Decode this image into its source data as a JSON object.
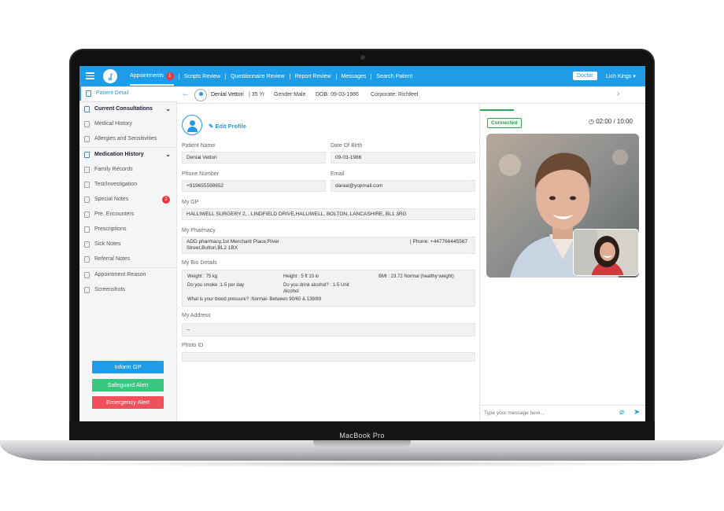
{
  "device": {
    "label": "MacBook Pro"
  },
  "header": {
    "nav": [
      {
        "label": "Appointments",
        "badge": "1",
        "active": true
      },
      {
        "label": "Scripts Review"
      },
      {
        "label": "Questionnaire Review"
      },
      {
        "label": "Report Review"
      },
      {
        "label": "Messages"
      },
      {
        "label": "Search Patient"
      }
    ],
    "role": "Doctor",
    "user": "Lich Kings"
  },
  "sidebar": {
    "items": [
      {
        "label": "Patient Detail"
      },
      {
        "label": "Current Consultations"
      },
      {
        "label": "Medical History"
      },
      {
        "label": "Allergies and Sensitivities"
      },
      {
        "label": "Medication History"
      },
      {
        "label": "Family Records"
      },
      {
        "label": "Test/Investigation"
      },
      {
        "label": "Special Notes",
        "badge": "2"
      },
      {
        "label": "Pre. Encounters"
      },
      {
        "label": "Prescriptions"
      },
      {
        "label": "Sick Notes"
      },
      {
        "label": "Referral Notes"
      },
      {
        "label": "Appointment Reason"
      },
      {
        "label": "Screenshots"
      }
    ],
    "buttons": {
      "inform_gp": "Inform GP",
      "safeguard": "Safeguard Alert",
      "emergency": "Emergency Alert"
    }
  },
  "patient_bar": {
    "name": "Denial Vettori",
    "age": "35 Yr",
    "gender_label": "Gender:",
    "gender": "Male",
    "dob_label": "DOB:",
    "dob": "09-03-1986",
    "corporate_label": "Corporate:",
    "corporate": "Richfeel"
  },
  "form": {
    "edit_profile": "Edit Profile",
    "patient_name_label": "Patient Name",
    "patient_name": "Denial Vettori",
    "dob_label": "Date Of Birth",
    "dob": "09-03-1986",
    "phone_label": "Phone Number",
    "phone": "+919655598652",
    "email_label": "Email",
    "email": "danial@yopmail.com",
    "gp_label": "My GP",
    "gp": "HALLIWELL SURGERY 2,  , LINDFIELD DRIVE,HALLIWELL, BOLTON, LANCASHIRE, BL1 3RG",
    "pharmacy_label": "My Pharmacy",
    "pharmacy_line1": "ADD pharmacy,1st Merchant Place,River",
    "pharmacy_line2": "Street,Bolton,BL2 1BX",
    "pharmacy_phone": "| Phone: +447766445567",
    "bio_label": "My Bio Details",
    "bio": {
      "weight": "Weight : 75 kg",
      "height": "Height : 5 ft 10 in",
      "bmi": "BMI : 23.72 Normal (healthy weight)",
      "smoke": "Do you smoke :1-5 per day",
      "alcohol_1": "Do you drink alcohol? : 1-5 Unit",
      "alcohol_2": "Alcohol",
      "bp": "What is your blood pressure? :Normal- Between 90/60 & 139/89"
    },
    "address_label": "My Address",
    "address": "--",
    "photo_label": "Photo ID"
  },
  "video": {
    "status": "Connected",
    "timer": "02:00 / 10:00",
    "message_placeholder": "Type your message here..."
  },
  "colors": {
    "primary": "#1e9ce8",
    "inform_gp": "#1e9ce8",
    "safeguard": "#37c77f",
    "emergency": "#f0505a",
    "connected": "#2fa74f"
  }
}
